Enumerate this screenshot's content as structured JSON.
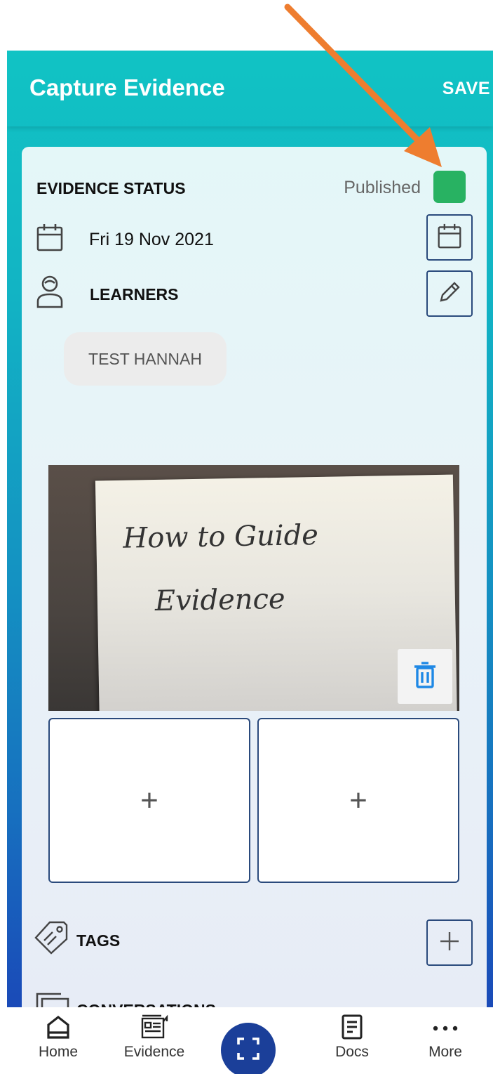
{
  "header": {
    "title": "Capture Evidence",
    "save_label": "SAVE"
  },
  "status": {
    "label": "EVIDENCE STATUS",
    "value": "Published",
    "color": "#28b262"
  },
  "date": {
    "value": "Fri 19 Nov 2021",
    "icon": "calendar-icon"
  },
  "learners": {
    "label": "LEARNERS",
    "icon": "person-icon",
    "items": [
      "TEST HANNAH"
    ]
  },
  "photo": {
    "handwriting_line1": "How to Guide",
    "handwriting_line2": "Evidence",
    "delete_icon": "trash-icon"
  },
  "media_slots": [
    {
      "symbol": "+"
    },
    {
      "symbol": "+"
    }
  ],
  "tags": {
    "label": "TAGS",
    "icon": "tag-icon"
  },
  "conversations": {
    "label": "CONVERSATIONS",
    "icon": "chat-icon"
  },
  "nav": {
    "items": [
      {
        "label": "Home",
        "icon": "home-icon"
      },
      {
        "label": "Evidence",
        "icon": "evidence-icon"
      },
      {
        "label": "Docs",
        "icon": "docs-icon"
      },
      {
        "label": "More",
        "icon": "more-icon"
      }
    ],
    "scan_icon": "scan-icon"
  },
  "colors": {
    "annotation_arrow": "#ee7d2f",
    "nav_accent": "#1b3f99",
    "delete_icon": "#1e88e5"
  }
}
